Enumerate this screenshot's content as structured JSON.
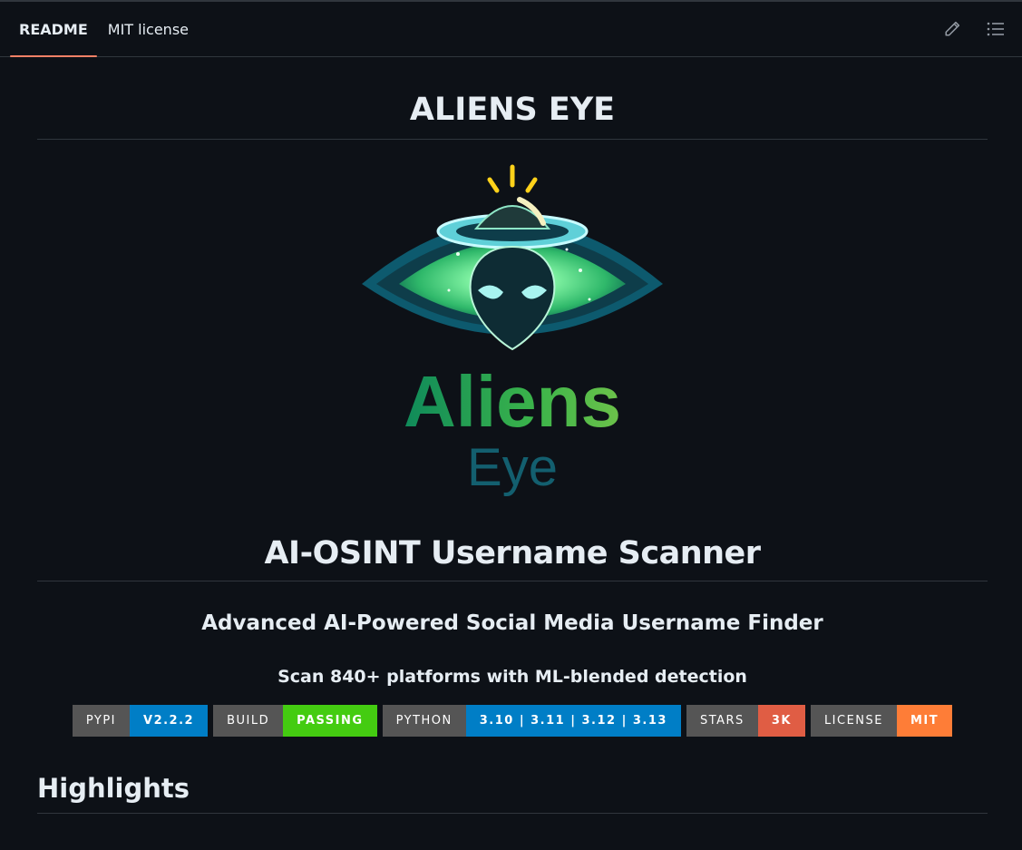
{
  "tabs": [
    {
      "label": "README",
      "active": true
    },
    {
      "label": "MIT license",
      "active": false
    }
  ],
  "actions": {
    "edit_icon": "pencil-icon",
    "toc_icon": "list-icon"
  },
  "readme": {
    "title": "ALIENS EYE",
    "logo": {
      "word1": "Aliens",
      "word2": "Eye"
    },
    "subtitle": "AI-OSINT Username Scanner",
    "tagline": "Advanced AI-Powered Social Media Username Finder",
    "scan_line": "Scan 840+ platforms with ML-blended detection",
    "badges": [
      {
        "key": "PYPI",
        "value": "V2.2.2",
        "color": "#007ec6"
      },
      {
        "key": "BUILD",
        "value": "PASSING",
        "color": "#44cc11"
      },
      {
        "key": "PYTHON",
        "value": "3.10 | 3.11 | 3.12 | 3.13",
        "color": "#007ec6"
      },
      {
        "key": "STARS",
        "value": "3K",
        "color": "#e05d44"
      },
      {
        "key": "LICENSE",
        "value": "MIT",
        "color": "#fe7d37"
      }
    ],
    "section_heading": "Highlights"
  },
  "colors": {
    "accent_underline": "#f78166",
    "bg": "#0d1117",
    "border": "#30363d"
  }
}
